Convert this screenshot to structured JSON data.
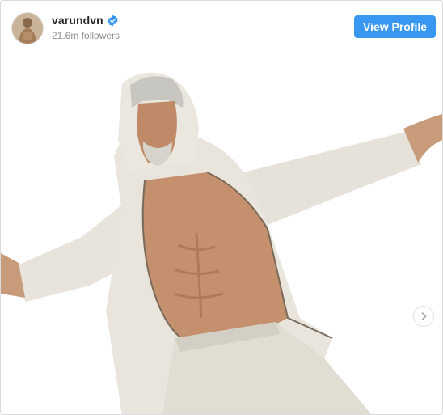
{
  "post": {
    "username": "varundvn",
    "verified": true,
    "followers": "21.6m followers",
    "view_profile_label": "View Profile"
  },
  "icons": {
    "verified": "verified-badge-icon",
    "next": "chevron-right-icon"
  },
  "colors": {
    "button": "#3897f0",
    "verified": "#3897f0",
    "username": "#262626",
    "followers": "#8e8e8e"
  }
}
